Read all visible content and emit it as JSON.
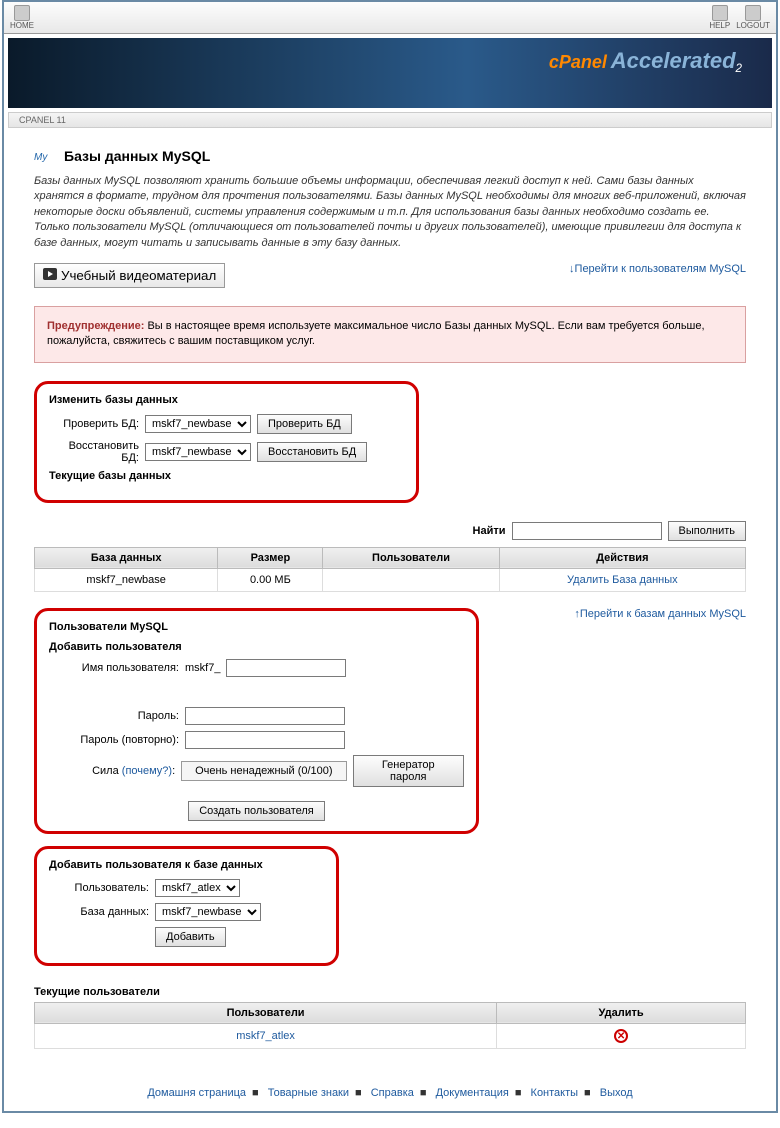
{
  "topbar": {
    "home": "HOME",
    "help": "HELP",
    "logout": "LOGOUT"
  },
  "banner": {
    "brand1": "cPanel",
    "brand2": "Accelerated",
    "sub": "2"
  },
  "breadcrumb": "CPANEL 11",
  "page": {
    "title": "Базы данных MySQL",
    "intro": "Базы данных MySQL позволяют хранить большие объемы информации, обеспечивая легкий доступ к ней. Сами базы данных хранятся в формате, трудном для прочтения пользователями. Базы данных MySQL необходимы для многих веб-приложений, включая некоторые доски объявлений, системы управления содержимым и т.п. Для использования базы данных необходимо создать ее. Только пользователи MySQL (отличающиеся от пользователей почты и других пользователей), имеющие привилегии для доступа к базе данных, могут читать и записывать данные в эту базу данных.",
    "video_btn": "Учебный видеоматериал",
    "jump_users": "Перейти к пользователям MySQL",
    "jump_dbs": "Перейти к базам данных MySQL"
  },
  "warning": {
    "label": "Предупреждение:",
    "text": " Вы в настоящее время используете максимальное число Базы данных MySQL. Если вам требуется больше, пожалуйста, свяжитесь с вашим поставщиком услуг."
  },
  "modify": {
    "heading": "Изменить базы данных",
    "check_label": "Проверить БД:",
    "check_value": "mskf7_newbase",
    "check_btn": "Проверить БД",
    "repair_label": "Восстановить БД:",
    "repair_value": "mskf7_newbase",
    "repair_btn": "Восстановить БД",
    "current_heading": "Текущие базы данных"
  },
  "search": {
    "label": "Найти",
    "btn": "Выполнить"
  },
  "db_table": {
    "h1": "База данных",
    "h2": "Размер",
    "h3": "Пользователи",
    "h4": "Действия",
    "r1_name": "mskf7_newbase",
    "r1_size": "0.00 МБ",
    "r1_users": "",
    "r1_action": "Удалить База данных"
  },
  "users": {
    "heading": "Пользователи MySQL",
    "add_heading": "Добавить пользователя",
    "name_label": "Имя пользователя:",
    "prefix": "mskf7_",
    "pass_label": "Пароль:",
    "pass2_label": "Пароль (повторно):",
    "strength_label": "Сила ",
    "strength_why": "(почему?)",
    "strength_colon": ":",
    "strength_value": "Очень ненадежный (0/100)",
    "gen_btn": "Генератор пароля",
    "create_btn": "Создать пользователя"
  },
  "assign": {
    "heading": "Добавить пользователя к базе данных",
    "user_label": "Пользователь:",
    "user_value": "mskf7_atlex",
    "db_label": "База данных:",
    "db_value": "mskf7_newbase",
    "add_btn": "Добавить"
  },
  "current_users": {
    "heading": "Текущие пользователи",
    "h1": "Пользователи",
    "h2": "Удалить",
    "r1_user": "mskf7_atlex"
  },
  "footer": {
    "f1": "Домашня страница",
    "f2": "Товарные знаки",
    "f3": "Справка",
    "f4": "Документация",
    "f5": "Контакты",
    "f6": "Выход"
  }
}
